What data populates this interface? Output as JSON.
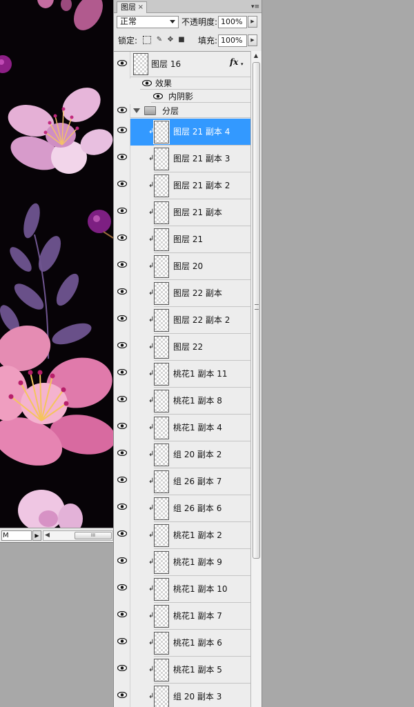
{
  "panel": {
    "tab_label": "图层",
    "tab_close": "×",
    "menu_icon": "panel-menu-icon",
    "blend_mode": "正常",
    "opacity_label": "不透明度:",
    "opacity_value": "100%",
    "lock_label": "锁定:",
    "fill_label": "填充:",
    "fill_value": "100%"
  },
  "document": {
    "zoom_value": "M",
    "scroll_thumb": "III"
  },
  "top_layer": {
    "name": "图层 16",
    "fx_label": "fx",
    "effects_label": "效果",
    "effect_item": "内阴影"
  },
  "group": {
    "name": "分层"
  },
  "layers": [
    {
      "name": "图层 21 副本 4",
      "selected": true
    },
    {
      "name": "图层 21 副本 3"
    },
    {
      "name": "图层 21 副本 2"
    },
    {
      "name": "图层 21 副本"
    },
    {
      "name": "图层 21"
    },
    {
      "name": "图层 20"
    },
    {
      "name": "图层 22 副本"
    },
    {
      "name": "图层 22 副本 2"
    },
    {
      "name": "图层 22"
    },
    {
      "name": "桃花1 副本 11"
    },
    {
      "name": "桃花1 副本 8"
    },
    {
      "name": "桃花1 副本 4"
    },
    {
      "name": "组 20 副本 2"
    },
    {
      "name": "组 26 副本 7"
    },
    {
      "name": "组 26 副本 6"
    },
    {
      "name": "桃花1 副本 2"
    },
    {
      "name": "桃花1 副本 9"
    },
    {
      "name": "桃花1 副本 10"
    },
    {
      "name": "桃花1 副本 7"
    },
    {
      "name": "桃花1 副本 6"
    },
    {
      "name": "桃花1 副本 5"
    },
    {
      "name": "组 20 副本 3"
    }
  ],
  "colors": {
    "selection": "#3399ff",
    "canvas_bg": "#070307",
    "petal_pink": "#e6a3cf",
    "leaf_purple": "#7d5e92"
  }
}
